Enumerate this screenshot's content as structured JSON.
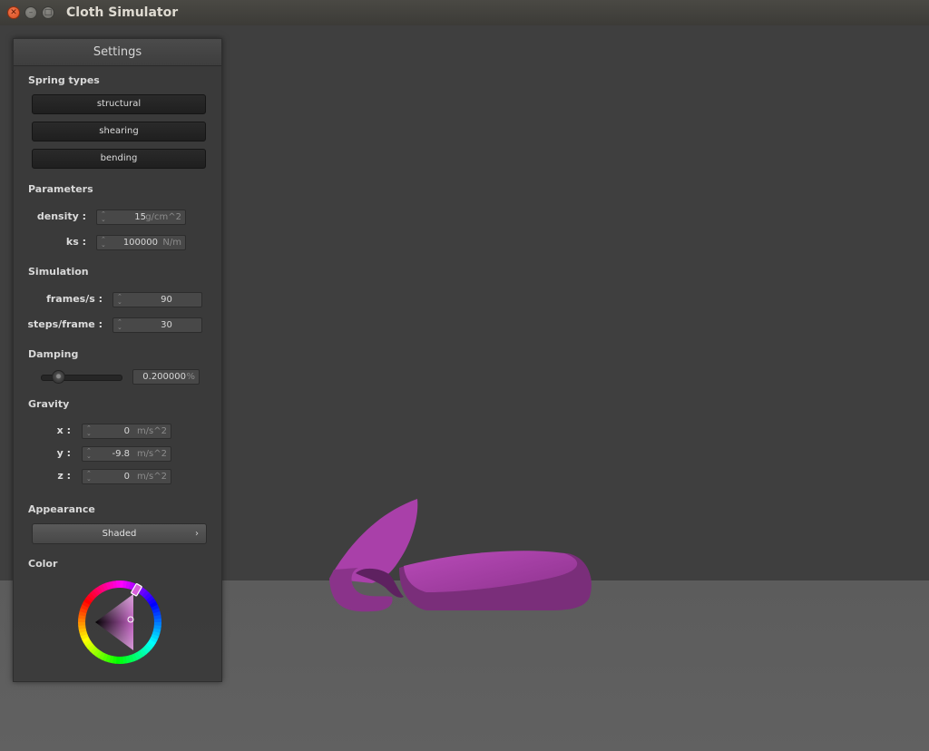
{
  "window": {
    "title": "Cloth Simulator"
  },
  "panel": {
    "title": "Settings",
    "spring_types": {
      "label": "Spring types",
      "buttons": [
        "structural",
        "shearing",
        "bending"
      ]
    },
    "parameters": {
      "label": "Parameters",
      "density": {
        "label": "density :",
        "value": "15",
        "unit": "g/cm^2"
      },
      "ks": {
        "label": "ks :",
        "value": "100000",
        "unit": "N/m"
      }
    },
    "simulation": {
      "label": "Simulation",
      "fps": {
        "label": "frames/s :",
        "value": "90"
      },
      "steps": {
        "label": "steps/frame :",
        "value": "30"
      }
    },
    "damping": {
      "label": "Damping",
      "slider_fraction": 0.2,
      "value": "0.200000",
      "unit": "%"
    },
    "gravity": {
      "label": "Gravity",
      "x": {
        "label": "x :",
        "value": "0",
        "unit": "m/s^2"
      },
      "y": {
        "label": "y :",
        "value": "-9.8",
        "unit": "m/s^2"
      },
      "z": {
        "label": "z :",
        "value": "0",
        "unit": "m/s^2"
      }
    },
    "appearance": {
      "label": "Appearance",
      "value": "Shaded"
    },
    "color": {
      "label": "Color",
      "selected_color": "#b040b0"
    }
  },
  "scene": {
    "background_color": "#3f3f3f",
    "floor_color": "#5e5e5e",
    "cloth_color": "#9a3a9a"
  }
}
